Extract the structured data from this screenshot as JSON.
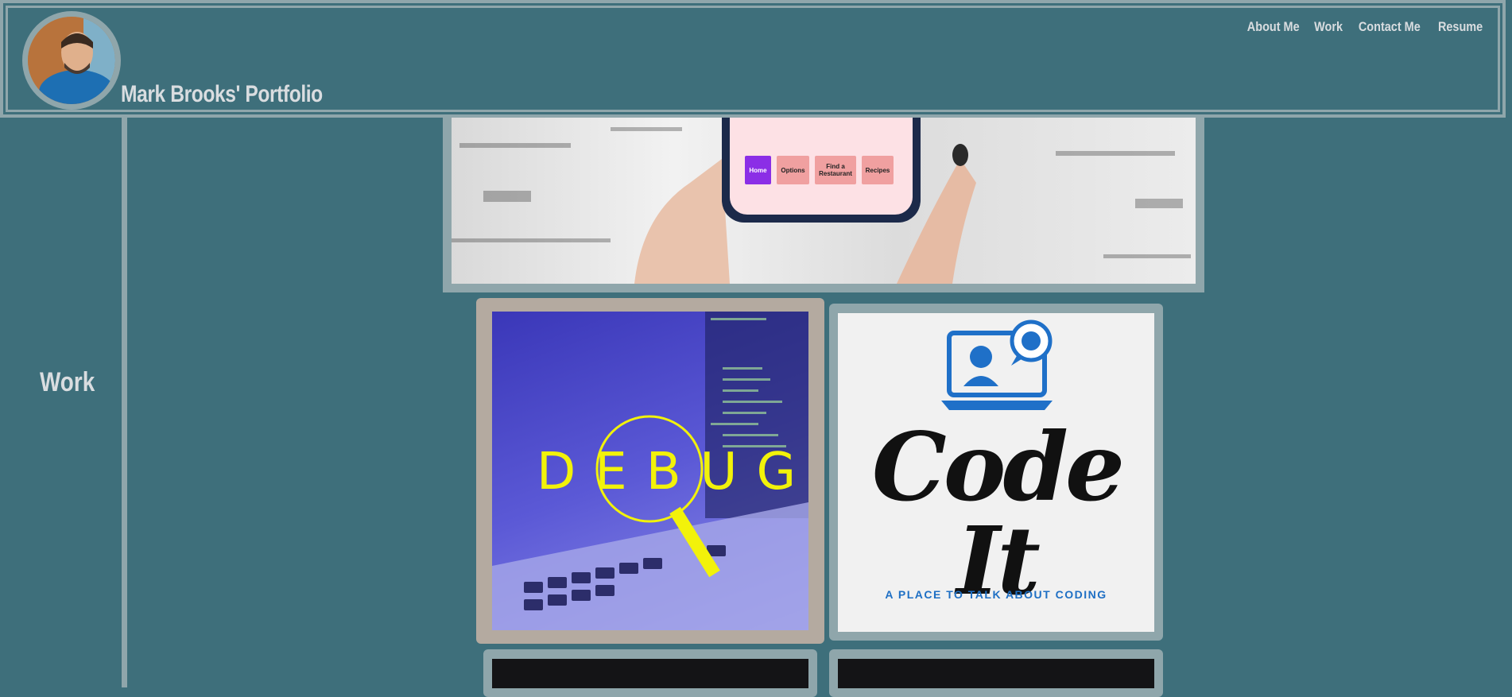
{
  "header": {
    "title": "Mark Brooks' Portfolio",
    "nav": [
      "About Me",
      "Work",
      "Contact Me",
      "Resume"
    ]
  },
  "sidebar": {
    "label": "Work"
  },
  "banner": {
    "phone_buttons": [
      "Home",
      "Options",
      "Find a Restaurant",
      "Recipes"
    ]
  },
  "tiles": [
    {
      "name": "debug",
      "text": "DEBUG"
    },
    {
      "name": "code-it",
      "title": "Code It",
      "tagline": "A PLACE TO TALK ABOUT CODING"
    }
  ],
  "colors": {
    "background": "#3e6f7b",
    "frame": "#8fa6ab",
    "active_frame": "#b4aaa0",
    "text": "#d9dde0"
  }
}
